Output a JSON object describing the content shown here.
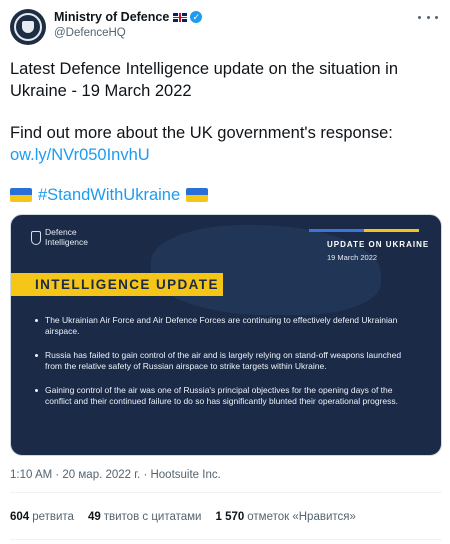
{
  "author": {
    "name": "Ministry of Defence",
    "handle": "@DefenceHQ",
    "verified_icon": "verified-badge-icon",
    "flag_icon": "uk-flag-icon"
  },
  "tweet": {
    "text_line1": "Latest Defence Intelligence update on the situation in Ukraine - 19 March 2022",
    "text_line2": "Find out more about the UK government's response:",
    "link": "ow.ly/NVr050InvhU",
    "hashtag": "#StandWithUkraine"
  },
  "media": {
    "brand": "Defence Intelligence",
    "update_title": "UPDATE ON UKRAINE",
    "update_date": "19 March 2022",
    "banner": "INTELLIGENCE UPDATE",
    "bullets": [
      "The Ukrainian Air Force and Air Defence Forces are continuing to effectively defend Ukrainian airspace.",
      "Russia has failed to gain control of the air and is largely relying on stand-off weapons launched from the relative safety of Russian airspace to strike targets within Ukraine.",
      "Gaining control of the air was one of Russia's principal objectives for the opening days of the conflict and their continued failure to do so has significantly blunted their operational progress."
    ]
  },
  "meta": {
    "timestamp": "1:10 AM · 20 мар. 2022 г. · Hootsuite Inc."
  },
  "stats": {
    "retweets_count": "604",
    "retweets_label": "ретвита",
    "quotes_count": "49",
    "quotes_label": "твитов с цитатами",
    "likes_count": "1 570",
    "likes_label": "отметок «Нравится»"
  },
  "colors": {
    "accent": "#1d9bf0",
    "card_bg": "#1a2a47",
    "banner_yellow": "#f5c518",
    "ukraine_blue": "#2a6fd6"
  }
}
